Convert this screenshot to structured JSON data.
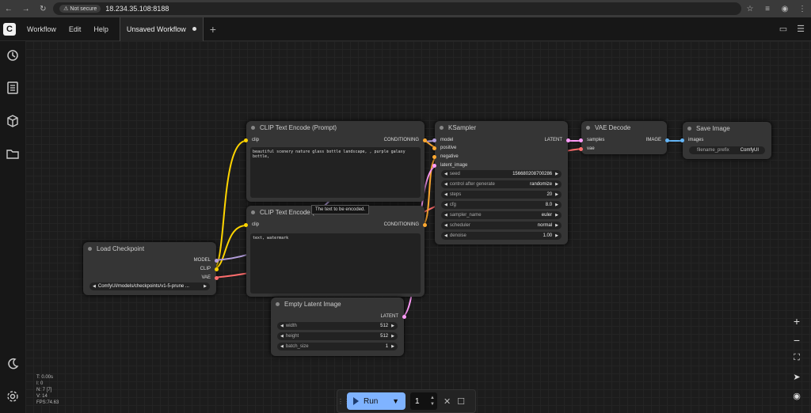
{
  "browser": {
    "not_secure": "Not secure",
    "url": "18.234.35.108:8188"
  },
  "menu": {
    "items": [
      "Workflow",
      "Edit",
      "Help"
    ],
    "tab": "Unsaved Workflow"
  },
  "nodes": {
    "clip_pos": {
      "title": "CLIP Text Encode (Prompt)",
      "in": "clip",
      "out": "CONDITIONING",
      "text": "beautiful scenery nature glass bottle landscape, , purple galaxy bottle,"
    },
    "clip_neg": {
      "title": "CLIP Text Encode (Prompt)",
      "title_visible": "CLIP Text Encode (",
      "in": "clip",
      "out": "CONDITIONING",
      "text": "text, watermark"
    },
    "ksampler": {
      "title": "KSampler",
      "inputs": [
        "model",
        "positive",
        "negative",
        "latent_image"
      ],
      "out": "LATENT",
      "widgets": [
        {
          "label": "seed",
          "value": "156680208700286"
        },
        {
          "label": "control after generate",
          "value": "randomize"
        },
        {
          "label": "steps",
          "value": "20"
        },
        {
          "label": "cfg",
          "value": "8.0"
        },
        {
          "label": "sampler_name",
          "value": "euler"
        },
        {
          "label": "scheduler",
          "value": "normal"
        },
        {
          "label": "denoise",
          "value": "1.00"
        }
      ]
    },
    "vae_decode": {
      "title": "VAE Decode",
      "inputs": [
        "samples",
        "vae"
      ],
      "out": "IMAGE"
    },
    "save_image": {
      "title": "Save Image",
      "in": "images",
      "widget_label": "filename_prefix",
      "widget_value": "ComfyUI"
    },
    "load_ckpt": {
      "title": "Load Checkpoint",
      "outputs": [
        "MODEL",
        "CLIP",
        "VAE"
      ],
      "ckpt": "ComfyUI/models/checkpoints/v1-5-prune ..."
    },
    "empty_latent": {
      "title": "Empty Latent Image",
      "out": "LATENT",
      "widgets": [
        {
          "label": "width",
          "value": "512"
        },
        {
          "label": "height",
          "value": "512"
        },
        {
          "label": "batch_size",
          "value": "1"
        }
      ]
    }
  },
  "tooltip": "The text to be encoded.",
  "stats": {
    "t": "T: 0.00s",
    "i": "I: 0",
    "n": "N: 7 [7]",
    "v": "V: 14",
    "fps": "FPS:74.63"
  },
  "run": {
    "label": "Run",
    "count": "1"
  },
  "colors": {
    "clip": "#ffd500",
    "model": "#b39ddb",
    "vae": "#ff6e6e",
    "latent": "#ff9cf9",
    "conditioning": "#ffa931",
    "image": "#64b5f6"
  }
}
